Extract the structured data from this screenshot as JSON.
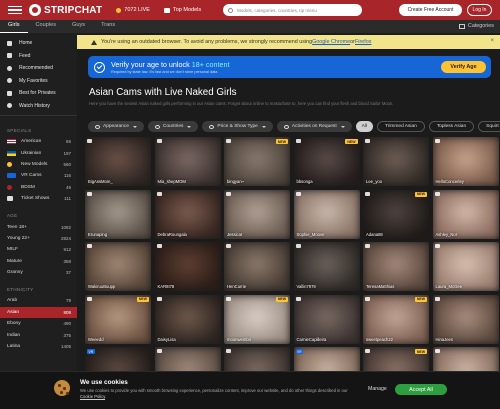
{
  "header": {
    "brand": "STRIPCHAT",
    "live_count": "7072 LIVE",
    "top_models": "Top Models",
    "search_placeholder": "Models, categories, countries, tip menu",
    "create_account": "Create Free Account",
    "login": "Log In",
    "accent_color": "#a8262a"
  },
  "tabs": [
    {
      "label": "Girls",
      "active": true
    },
    {
      "label": "Couples",
      "active": false
    },
    {
      "label": "Guys",
      "active": false
    },
    {
      "label": "Trans",
      "active": false
    }
  ],
  "categories_label": "Categories",
  "sidebar": {
    "nav": [
      {
        "label": "Home",
        "icon": "home-icon"
      },
      {
        "label": "Feed",
        "icon": "feed-icon"
      },
      {
        "label": "Recommended",
        "icon": "recommended-icon"
      },
      {
        "label": "My Favorites",
        "icon": "heart-icon"
      },
      {
        "label": "Best for Privates",
        "icon": "star-icon"
      },
      {
        "label": "Watch History",
        "icon": "history-icon"
      }
    ],
    "specials_heading": "SPECIALS",
    "specials": [
      {
        "label": "American",
        "count": "65",
        "flag": "us"
      },
      {
        "label": "Ukrainian",
        "count": "197",
        "flag": "ua"
      },
      {
        "label": "New Models",
        "count": "560",
        "flag": "new"
      },
      {
        "label": "VR Cams",
        "count": "116",
        "flag": "vr"
      },
      {
        "label": "BDSM",
        "count": "49",
        "flag": "bdsm"
      },
      {
        "label": "Ticket Shows",
        "count": "111",
        "flag": "ticket"
      }
    ],
    "age_heading": "AGE",
    "age": [
      {
        "label": "Teen 18+",
        "count": "1082"
      },
      {
        "label": "Young 22+",
        "count": "2824"
      },
      {
        "label": "MILF",
        "count": "912"
      },
      {
        "label": "Mature",
        "count": "358"
      },
      {
        "label": "Granny",
        "count": "37"
      }
    ],
    "ethnicity_heading": "ETHNICITY",
    "ethnicity": [
      {
        "label": "Arab",
        "count": "79",
        "active": false
      },
      {
        "label": "Asian",
        "count": "808",
        "active": true
      },
      {
        "label": "Ebony",
        "count": "490",
        "active": false
      },
      {
        "label": "Indian",
        "count": "375",
        "active": false
      },
      {
        "label": "Latina",
        "count": "1405",
        "active": false
      }
    ]
  },
  "warning": {
    "text_before": "You're using an outdated browser. To avoid any problems, we strongly recommend using ",
    "chrome": "Google Chrome",
    "or": " or ",
    "firefox": "Firefox",
    "close": "×"
  },
  "verify": {
    "title_before": "Verify your age to unlock ",
    "title_highlight": "18+ content",
    "subtitle": "Required by state law. It's fast and we don't store personal data",
    "button": "Verify Age"
  },
  "page": {
    "title": "Asian Cams with Live Naked Girls",
    "description": "Here you have the sexiest Asian naked girls performing in our Asian cams. Forget about online to masturbate to, here you can find your flesh and blood Sailor Moon."
  },
  "filters": [
    {
      "label": "Appearance",
      "type": "dropdown"
    },
    {
      "label": "Countries",
      "type": "dropdown"
    },
    {
      "label": "Price & Show Type",
      "type": "dropdown"
    },
    {
      "label": "Activities on Request",
      "type": "dropdown"
    },
    {
      "label": "All",
      "type": "all"
    },
    {
      "label": "Trimmed Asian",
      "type": "tag"
    },
    {
      "label": "Topless Asian",
      "type": "tag"
    },
    {
      "label": "Squirt Asian",
      "type": "tag"
    }
  ],
  "cards": [
    {
      "name": "BigAssMom_",
      "new": false,
      "vr": false,
      "c1": "#6b5148",
      "c2": "#2c2420"
    },
    {
      "name": "Mia_shepMOM",
      "new": false,
      "vr": false,
      "c1": "#7d6a64",
      "c2": "#3a302e"
    },
    {
      "name": "bingyan~",
      "new": true,
      "vr": false,
      "c1": "#8a7a70",
      "c2": "#4c423a"
    },
    {
      "name": "bbsonga",
      "new": true,
      "vr": false,
      "c1": "#5a4c48",
      "c2": "#231c1c"
    },
    {
      "name": "Lee_yoo",
      "new": false,
      "vr": false,
      "c1": "#6e5f55",
      "c2": "#2f2824"
    },
    {
      "name": "HelloConcerley",
      "new": false,
      "vr": false,
      "c1": "#c7a48e",
      "c2": "#7a5a4a"
    },
    {
      "name": "Erunaping",
      "new": false,
      "vr": false,
      "c1": "#a59a90",
      "c2": "#5a4f46"
    },
    {
      "name": "DebraRoungala",
      "new": false,
      "vr": false,
      "c1": "#7c5c50",
      "c2": "#372620"
    },
    {
      "name": "Jessicat",
      "new": false,
      "vr": false,
      "c1": "#b2a296",
      "c2": "#6b5c52"
    },
    {
      "name": "Sophie_Moove",
      "new": false,
      "vr": false,
      "c1": "#c9b9ad",
      "c2": "#8a7366"
    },
    {
      "name": "Adana88",
      "new": true,
      "vr": false,
      "c1": "#4f4440",
      "c2": "#1f1a18"
    },
    {
      "name": "Ashley_Nor",
      "new": false,
      "vr": false,
      "c1": "#d4b9aa",
      "c2": "#8c6c5f"
    },
    {
      "name": "WakiruuBuupp",
      "new": false,
      "vr": false,
      "c1": "#a28876",
      "c2": "#574538"
    },
    {
      "name": "KAR8I78",
      "new": false,
      "vr": false,
      "c1": "#5f3f33",
      "c2": "#2a1c16"
    },
    {
      "name": "HenCurrie",
      "new": false,
      "vr": false,
      "c1": "#8d7a6c",
      "c2": "#453a32"
    },
    {
      "name": "Vallin7979",
      "new": false,
      "vr": false,
      "c1": "#6c625c",
      "c2": "#2e2926"
    },
    {
      "name": "TeresaMatthias",
      "new": false,
      "vr": false,
      "c1": "#a48a7c",
      "c2": "#5a463c"
    },
    {
      "name": "Laura_McGee",
      "new": false,
      "vr": false,
      "c1": "#d8c0b0",
      "c2": "#9a7e70"
    },
    {
      "name": "Weeedd",
      "new": true,
      "vr": false,
      "c1": "#b89a82",
      "c2": "#6a5040"
    },
    {
      "name": "DaisyLisa",
      "new": false,
      "vr": false,
      "c1": "#6f5a4d",
      "c2": "#2e241f"
    },
    {
      "name": "moonwembri",
      "new": true,
      "vr": false,
      "c1": "#d9cfc8",
      "c2": "#9c8e84"
    },
    {
      "name": "CarnieCapilleira",
      "new": false,
      "vr": false,
      "c1": "#7a6a62",
      "c2": "#3b3230"
    },
    {
      "name": "sweetpeach22",
      "new": true,
      "vr": false,
      "c1": "#c2a696",
      "c2": "#7e6052"
    },
    {
      "name": "HinaJeen",
      "new": false,
      "vr": false,
      "c1": "#a98e7e",
      "c2": "#5c483d"
    },
    {
      "name": "",
      "new": false,
      "vr": true,
      "c1": "#5c4a42",
      "c2": "#241c18"
    },
    {
      "name": "",
      "new": false,
      "vr": false,
      "c1": "#a08a7c",
      "c2": "#584a40"
    },
    {
      "name": "",
      "new": false,
      "vr": false,
      "c1": "#7c6c62",
      "c2": "#3a302c"
    },
    {
      "name": "",
      "new": false,
      "vr": true,
      "c1": "#c9b2a2",
      "c2": "#7e6658"
    },
    {
      "name": "",
      "new": true,
      "vr": false,
      "c1": "#8a7266",
      "c2": "#423530"
    },
    {
      "name": "",
      "new": false,
      "vr": false,
      "c1": "#cdb4a4",
      "c2": "#836a5c"
    }
  ],
  "cookie": {
    "title": "We use cookies",
    "text_before": "We use cookies to provide you with smooth browsing experience, personalize content, improve our website, and do other things described in our ",
    "policy_link": "Cookie Policy",
    "text_after": ".",
    "manage": "Manage",
    "accept": "Accept All"
  }
}
